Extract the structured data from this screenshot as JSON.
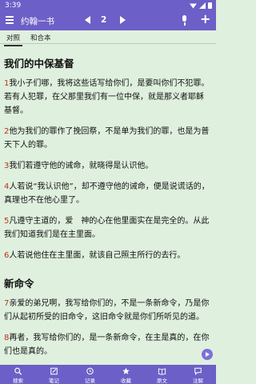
{
  "status": {
    "time": "3:39"
  },
  "appbar": {
    "title": "约翰一书",
    "chapter": "2"
  },
  "tabs": [
    {
      "label": "对照"
    },
    {
      "label": "和合本"
    }
  ],
  "content": {
    "heading1": "我们的中保基督",
    "heading2": "新命令",
    "verses": [
      {
        "num": "1",
        "text": "我小子们哪，我将这些话写给你们，是要叫你们不犯罪。若有人犯罪，在父那里我们有一位中保，就是那义者耶稣基督。"
      },
      {
        "num": "2",
        "text": "他为我们的罪作了挽回祭，不是单为我们的罪，也是为普天下人的罪。"
      },
      {
        "num": "3",
        "text": "我们若遵守他的诫命，就晓得是认识他。"
      },
      {
        "num": "4",
        "text": "人若说“我认识他”，却不遵守他的诫命，便是说谎话的，真理也不在他心里了。"
      },
      {
        "num": "5",
        "text": "凡遵守主道的，爱　神的心在他里面实在是完全的。从此我们知道我们是在主里面。"
      },
      {
        "num": "6",
        "text": "人若说他住在主里面，就该自己照主所行的去行。"
      },
      {
        "num": "7",
        "text": "亲爱的弟兄啊，我写给你们的，不是一条新命令，乃是你们从起初所受的旧命令，这旧命令就是你们所听见的道。"
      },
      {
        "num": "8",
        "text": "再者，我写给你们的，是一条新命令，在主是真的，在你们也是真的。"
      }
    ]
  },
  "bottom_nav": [
    {
      "label": "搜索",
      "icon": "search-icon"
    },
    {
      "label": "笔记",
      "icon": "note-icon"
    },
    {
      "label": "记录",
      "icon": "history-icon"
    },
    {
      "label": "收藏",
      "icon": "star-icon"
    },
    {
      "label": "原文",
      "icon": "book-icon"
    },
    {
      "label": "注解",
      "icon": "comment-icon"
    }
  ],
  "colors": {
    "primary": "#6c5fc7",
    "background": "#dff0de",
    "verse_number": "#c1331b"
  }
}
